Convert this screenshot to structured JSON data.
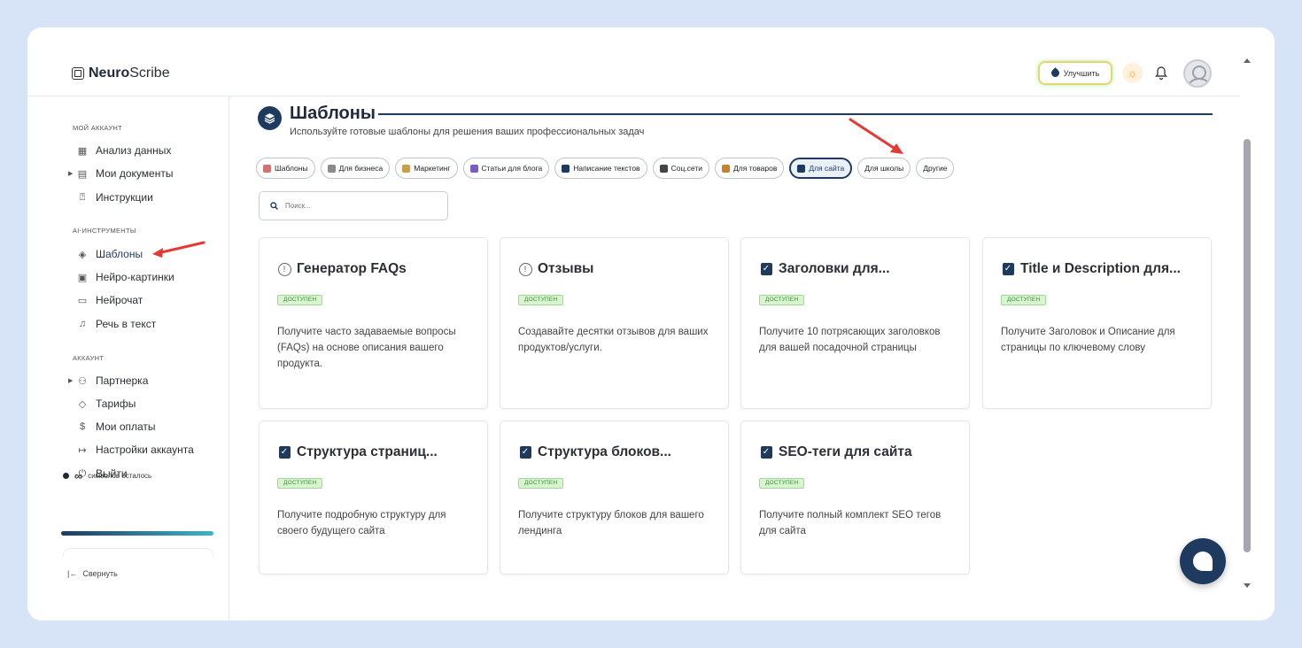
{
  "app": {
    "logo_bold": "Neuro",
    "logo_light": "Scribe"
  },
  "header": {
    "upgrade_label": "Улучшить"
  },
  "sidebar": {
    "sections": {
      "account": "МОЙ АККАУНТ",
      "ai_tools": "AI-ИНСТРУМЕНТЫ",
      "settings": "АККАУНТ"
    },
    "items": {
      "analytics": "Анализ данных",
      "documents": "Мои документы",
      "instructions": "Инструкции",
      "templates": "Шаблоны",
      "images": "Нейро-картинки",
      "chat": "Нейрочат",
      "speech": "Речь в текст",
      "partner": "Партнерка",
      "tariffs": "Тарифы",
      "payments": "Мои оплаты",
      "account_settings": "Настройки аккаунта",
      "logout": "Выйти"
    },
    "credits_symbol": "∞",
    "credits_label": "символов осталось",
    "credits_fraction": 1.0,
    "collapse_label": "Свернуть"
  },
  "main": {
    "title": "Шаблоны",
    "subtitle": "Используйте готовые шаблоны для решения ваших профессиональных задач",
    "search_placeholder": "Поиск...",
    "categories": [
      {
        "label": "Шаблоны",
        "icon": "checkbox-icon",
        "color": "#e06b6b"
      },
      {
        "label": "Для бизнеса",
        "icon": "calendar-icon",
        "color": "#8a8a8a"
      },
      {
        "label": "Маркетинг",
        "icon": "memo-icon",
        "color": "#c9a04a"
      },
      {
        "label": "Статьи для блога",
        "icon": "books-icon",
        "color": "#7a5ac8"
      },
      {
        "label": "Написание текстов",
        "icon": "phone-icon",
        "color": "#1e3a5f"
      },
      {
        "label": "Соц.сети",
        "icon": "laptop-icon",
        "color": "#444444"
      },
      {
        "label": "Для товаров",
        "icon": "ledger-icon",
        "color": "#c8802e"
      },
      {
        "label": "Для сайта",
        "icon": "globe-icon",
        "color": "#1e3a5f"
      },
      {
        "label": "Для школы",
        "icon": "",
        "color": ""
      },
      {
        "label": "Другие",
        "icon": "",
        "color": ""
      }
    ],
    "cards": [
      {
        "title": "Генератор FAQs",
        "badge": "ДОСТУПЕН",
        "description": "Получите часто задаваемые вопросы (FAQs) на основе описания вашего продукта.",
        "icon": "info-icon"
      },
      {
        "title": "Отзывы",
        "badge": "ДОСТУПЕН",
        "description": "Создавайте десятки отзывов для ваших продуктов/услуги.",
        "icon": "info-icon"
      },
      {
        "title": "Заголовки для...",
        "badge": "ДОСТУПЕН",
        "description": "Получите 10 потрясающих заголовков для вашей посадочной страницы",
        "icon": "check-icon"
      },
      {
        "title": "Title и Description для...",
        "badge": "ДОСТУПЕН",
        "description": "Получите Заголовок и Описание для страницы по ключевому слову",
        "icon": "check-icon"
      },
      {
        "title": "Структура страниц...",
        "badge": "ДОСТУПЕН",
        "description": "Получите подробную структуру для своего будущего сайта",
        "icon": "check-icon"
      },
      {
        "title": "Структура блоков...",
        "badge": "ДОСТУПЕН",
        "description": "Получите структуру блоков для вашего лендинга",
        "icon": "check-icon"
      },
      {
        "title": "SEO-теги для сайта",
        "badge": "ДОСТУПЕН",
        "description": "Получите полный комплект SEO тегов для сайта",
        "icon": "check-icon"
      }
    ]
  },
  "colors": {
    "accent": "#1e3a5f",
    "badge_bg": "#d8f5d0",
    "annotation": "#e53935"
  }
}
